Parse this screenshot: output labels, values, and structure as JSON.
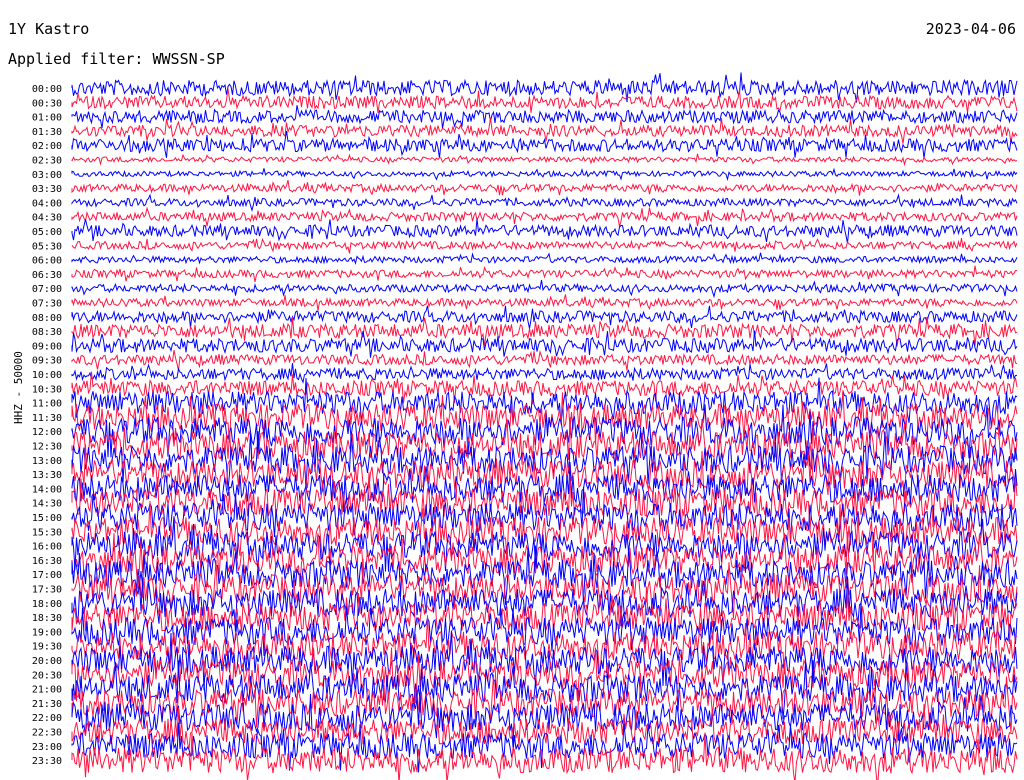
{
  "header": {
    "station": "1Y Kastro",
    "date": "2023-04-06",
    "filter": "Applied filter: WWSSN-SP"
  },
  "colors": {
    "trace_a": "#0000ff",
    "trace_b": "#ff1744"
  },
  "chart_data": {
    "type": "line",
    "title": "1Y Kastro",
    "date": "2023-04-06",
    "ylabel": "HHZ - 50000",
    "row_labels": [
      "00:00",
      "00:30",
      "01:00",
      "01:30",
      "02:00",
      "02:30",
      "03:00",
      "03:30",
      "04:00",
      "04:30",
      "05:00",
      "05:30",
      "06:00",
      "06:30",
      "07:00",
      "07:30",
      "08:00",
      "08:30",
      "09:00",
      "09:30",
      "10:00",
      "10:30",
      "11:00",
      "11:30",
      "12:00",
      "12:30",
      "13:00",
      "13:30",
      "14:00",
      "14:30",
      "15:00",
      "15:30",
      "16:00",
      "16:30",
      "17:00",
      "17:30",
      "18:00",
      "18:30",
      "19:00",
      "19:30",
      "20:00",
      "20:30",
      "21:00",
      "21:30",
      "22:00",
      "22:30",
      "23:00",
      "23:30"
    ],
    "row_amplitude": [
      0.6,
      0.5,
      0.5,
      0.45,
      0.5,
      0.2,
      0.2,
      0.3,
      0.3,
      0.35,
      0.45,
      0.3,
      0.25,
      0.3,
      0.3,
      0.3,
      0.45,
      0.55,
      0.55,
      0.4,
      0.45,
      0.6,
      0.9,
      1.0,
      1.1,
      1.1,
      1.1,
      1.1,
      1.1,
      1.1,
      1.1,
      1.1,
      1.1,
      1.1,
      1.1,
      1.1,
      1.1,
      1.1,
      1.1,
      1.1,
      1.1,
      1.1,
      1.1,
      1.1,
      1.1,
      1.0,
      1.0,
      1.0
    ],
    "row_color_pattern": [
      "blue",
      "red"
    ],
    "minutes_per_row": 30
  }
}
